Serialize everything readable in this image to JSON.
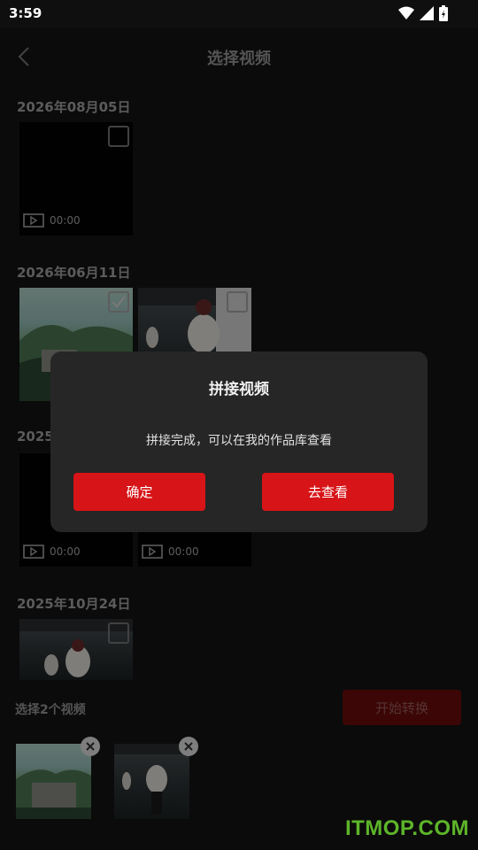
{
  "status_bar": {
    "time": "3:59"
  },
  "header": {
    "title": "选择视频"
  },
  "groups": [
    {
      "date": "2026年08月05日",
      "items": [
        {
          "duration": "00:00",
          "checked": false
        }
      ]
    },
    {
      "date": "2026年06月11日",
      "items": [
        {
          "checked": true
        },
        {
          "checked": true
        }
      ]
    },
    {
      "date": "2025",
      "items": [
        {
          "duration": "00:00"
        },
        {
          "duration": "00:00"
        }
      ]
    },
    {
      "date": "2025年10月24日",
      "items": [
        {
          "checked": false
        }
      ]
    }
  ],
  "footer": {
    "select_count": "选择2个视频",
    "start_button": "开始转换"
  },
  "dialog": {
    "title": "拼接视频",
    "message": "拼接完成，可以在我的作品库查看",
    "confirm": "确定",
    "view": "去查看"
  },
  "watermark": "ITMOP.COM",
  "colors": {
    "accent": "#d71417",
    "disabled_accent": "#6e0c0c",
    "background": "#141414",
    "dialog": "#262626"
  }
}
